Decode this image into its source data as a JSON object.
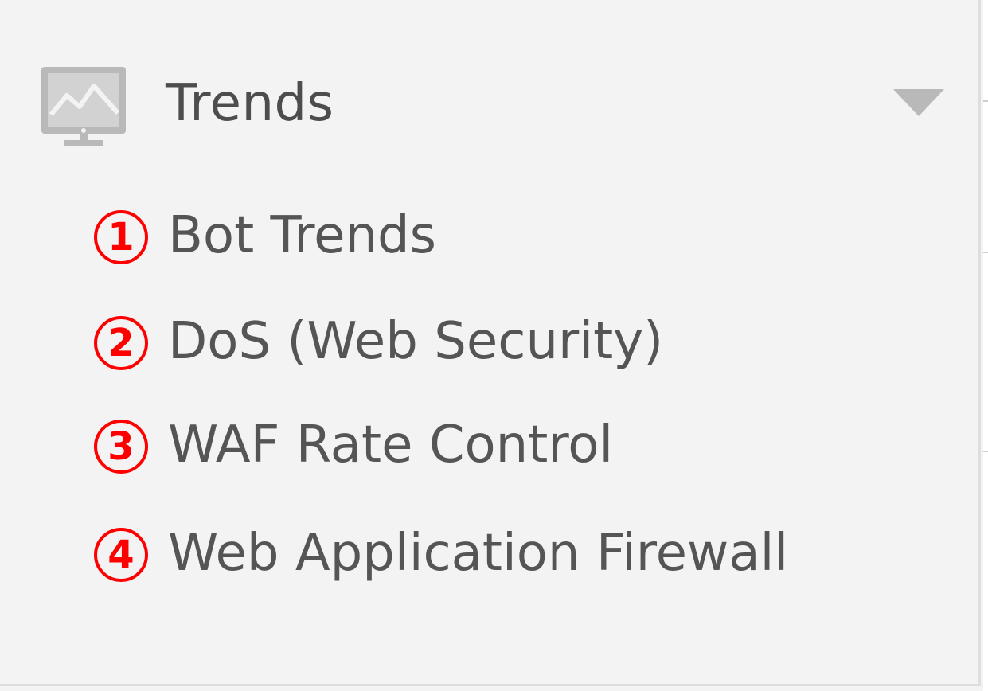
{
  "section": {
    "title": "Trends",
    "icon": "monitor-chart-icon",
    "expanded": true
  },
  "items": [
    {
      "marker": "1",
      "label": "Bot Trends"
    },
    {
      "marker": "2",
      "label": "DoS (Web Security)"
    },
    {
      "marker": "3",
      "label": "WAF Rate Control"
    },
    {
      "marker": "4",
      "label": "Web Application Firewall"
    }
  ],
  "colors": {
    "background": "#f3f3f3",
    "text": "#555555",
    "icon": "#b9b9b9",
    "marker": "#ff0000"
  }
}
